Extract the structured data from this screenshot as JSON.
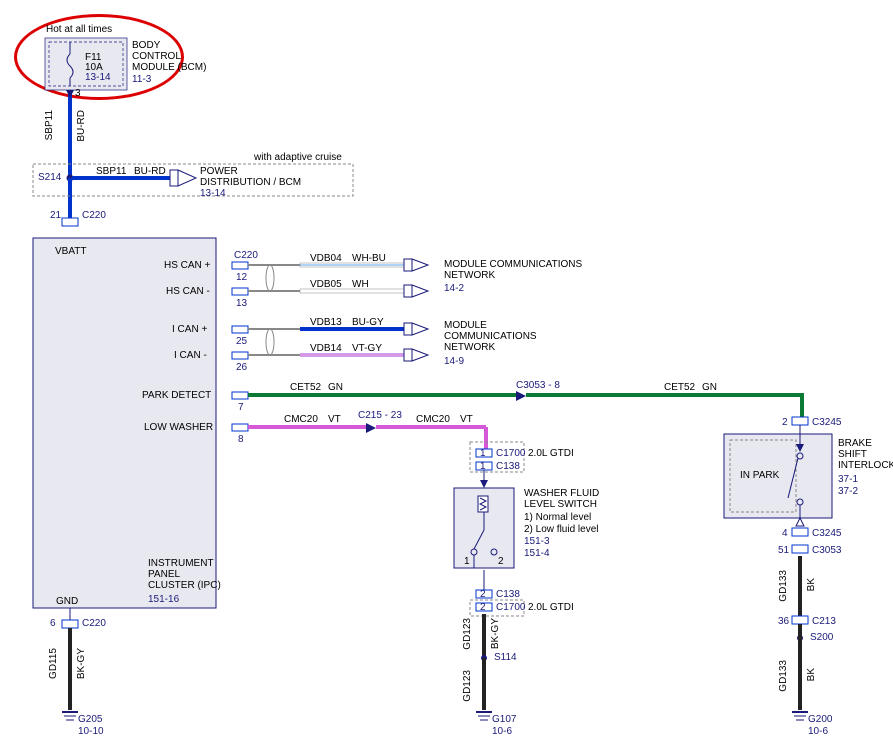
{
  "header": {
    "hot_label": "Hot at all times",
    "bcm_box": {
      "fuse": "F11",
      "amps": "10A",
      "ref": "13-14"
    },
    "bcm_text": "BODY\nCONTROL\nMODULE (BCM)",
    "bcm_ref": "11-3"
  },
  "wires": {
    "sbp11": "SBP11",
    "burd": "BU-RD",
    "sbp11_2": "SBP11",
    "burd_2": "BU-RD"
  },
  "splice": {
    "s214": "S214"
  },
  "power_dist": {
    "label": "POWER\nDISTRIBUTION / BCM",
    "ref": "13-14",
    "note": "with adaptive cruise"
  },
  "connectors": {
    "c220_top_pin": "21",
    "c220_top": "C220",
    "c220_hs": "C220",
    "hs_pin1": "12",
    "hs_pin2": "13",
    "ican_pin1": "25",
    "ican_pin2": "26",
    "park_pin": "7",
    "low_pin": "8",
    "c215": "C215 - 23",
    "c3053": "C3053 - 8",
    "c1700_1": "C1700",
    "c1700_1_pin": "1",
    "c138_1": "C138",
    "c138_1_pin": "1",
    "c138_2": "C138",
    "c138_2_pin": "2",
    "c1700_2": "C1700",
    "c1700_2_pin": "2",
    "c3245_1": "C3245",
    "c3245_1_pin": "2",
    "c3245_2": "C3245",
    "c3245_2_pin": "4",
    "c3053_2": "C3053",
    "c3053_2_pin": "51",
    "c213": "C213",
    "c213_pin": "36",
    "c220_gnd": "C220",
    "c220_gnd_pin": "6"
  },
  "module_box": {
    "vbatt": "VBATT",
    "hscan_p": "HS CAN +",
    "hscan_m": "HS CAN -",
    "ican_p": "I CAN +",
    "ican_m": "I CAN -",
    "park": "PARK DETECT",
    "low": "LOW WASHER",
    "gnd": "GND",
    "name": "INSTRUMENT\nPANEL\nCLUSTER (IPC)",
    "ref": "151-16"
  },
  "can_wires": {
    "vdb04": "VDB04",
    "vdb04_c": "WH-BU",
    "vdb05": "VDB05",
    "vdb05_c": "WH",
    "vdb13": "VDB13",
    "vdb13_c": "BU-GY",
    "vdb14": "VDB14",
    "vdb14_c": "VT-GY"
  },
  "comms": {
    "mcn1": "MODULE COMMUNICATIONS\nNETWORK",
    "mcn1_ref": "14-2",
    "mcn2": "MODULE\nCOMMUNICATIONS\nNETWORK",
    "mcn2_ref": "14-9"
  },
  "park_wire": {
    "id": "CET52",
    "color": "GN",
    "id2": "CET52",
    "color2": "GN"
  },
  "low_wire": {
    "id": "CMC20",
    "color": "VT",
    "id2": "CMC20",
    "color2": "VT"
  },
  "gtdi": {
    "label1": "2.0L GTDI",
    "label2": "2.0L GTDI"
  },
  "washer": {
    "title": "WASHER FLUID\nLEVEL SWITCH",
    "n1": "1) Normal level",
    "n2": "2) Low fluid level",
    "ref1": "151-3",
    "ref2": "151-4",
    "sw1": "1",
    "sw2": "2"
  },
  "brake": {
    "in_park": "IN PARK",
    "title": "BRAKE\nSHIFT\nINTERLOCK",
    "ref1": "37-1",
    "ref2": "37-2"
  },
  "grounds": {
    "gd115": "GD115",
    "bkgy1": "BK-GY",
    "g205": "G205",
    "g205_ref": "10-10",
    "gd123": "GD123",
    "bkgy2": "BK-GY",
    "s114": "S114",
    "g107": "G107",
    "g107_ref": "10-6",
    "gd123_2": "GD123",
    "gd133": "GD133",
    "bk1": "BK",
    "s200": "S200",
    "g200": "G200",
    "g200_ref": "10-6",
    "gd133_2": "GD133",
    "bk2": "BK"
  }
}
